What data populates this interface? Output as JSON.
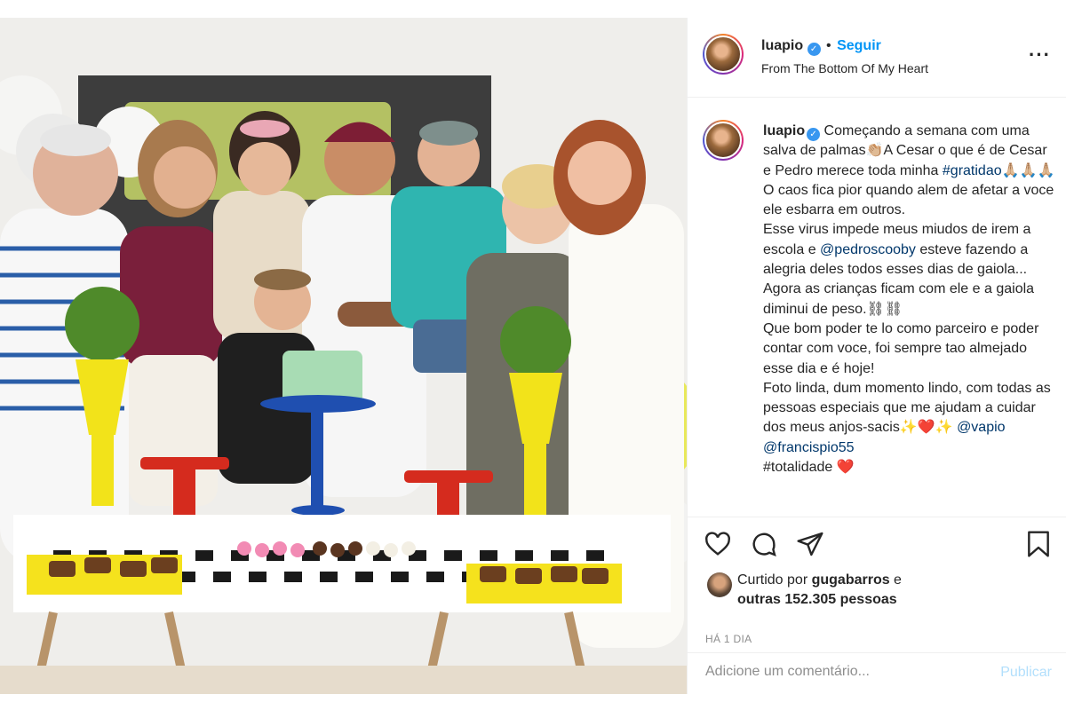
{
  "post": {
    "username": "luapio",
    "verified_badge": "✓",
    "separator": "•",
    "follow_label": "Seguir",
    "location": "From The Bottom Of My Heart",
    "more_icon": "more-horizontal-icon",
    "more_glyph": "···"
  },
  "caption": {
    "username": "luapio",
    "line1_text": " Começando a semana com uma salva de palmas👏🏼A Cesar o que é de Cesar e Pedro merece toda minha ",
    "hashtag": "#gratidao",
    "after_hashtag": "🙏🏼🙏🏼🙏🏼",
    "p2": "O caos fica pior quando alem de afetar a voce ele esbarra em outros.",
    "p3a": "Esse virus impede meus miudos de irem a escola e ",
    "mention1": "@pedroscooby",
    "p3b": " esteve fazendo a alegria deles todos esses dias de gaiola...",
    "p4": "Agora as crianças ficam com ele e a gaiola diminui de peso.⛓⛓",
    "p5": "Que bom poder te lo como parceiro e poder contar com voce, foi sempre tao almejado esse dia e é hoje!",
    "p6a": "Foto linda, dum momento lindo, com todas as pessoas especiais que me ajudam a cuidar dos meus anjos-sacis",
    "p6_emojis": "✨❤️✨ ",
    "mention2": "@vapio",
    "mention3": "@francispio55",
    "p7": "#totalidade ❤️"
  },
  "actions": {
    "like_icon": "heart-icon",
    "comment_icon": "comment-icon",
    "share_icon": "share-icon",
    "save_icon": "bookmark-icon",
    "liked_prefix": "Curtido por ",
    "liked_user": "gugabarros",
    "liked_mid": " e",
    "liked_others": "outras 152.305 pessoas",
    "timestamp": "HÁ 1 DIA",
    "comment_placeholder": "Adicione um comentário...",
    "publish_label": "Publicar"
  },
  "colors": {
    "accent": "#0095f6",
    "verified": "#3897f0",
    "publish_disabled": "#b2dffc",
    "muted": "#8e8e8e",
    "tag": "#00376b"
  }
}
